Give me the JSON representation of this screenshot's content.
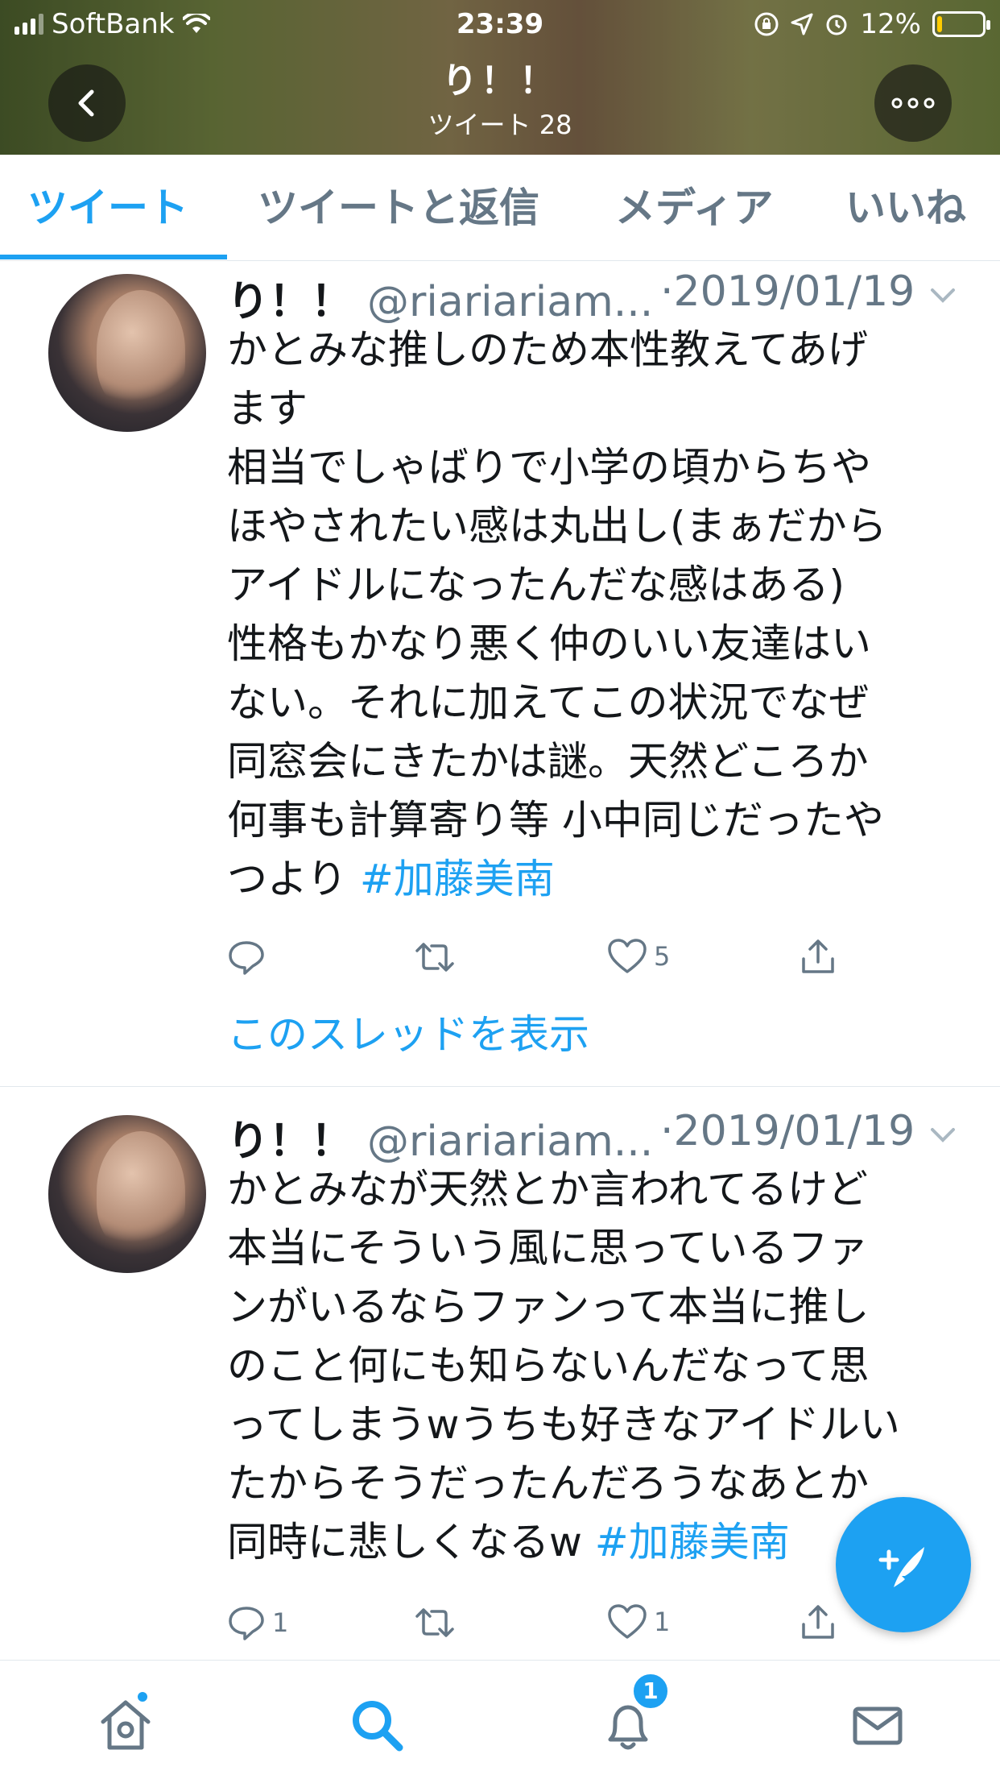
{
  "status_bar": {
    "carrier": "SoftBank",
    "time": "23:39",
    "battery": "12%",
    "battery_level": 0.12
  },
  "header": {
    "title": "り！！",
    "subtitle": "ツイート 28"
  },
  "tabs": [
    {
      "label": "ツイート",
      "active": true
    },
    {
      "label": "ツイートと返信",
      "active": false
    },
    {
      "label": "メディア",
      "active": false
    },
    {
      "label": "いいね",
      "active": false
    }
  ],
  "tweets": [
    {
      "name": "り！！",
      "handle": "@riariariam...",
      "date": "·2019/01/19",
      "text": "かとみな推しのため本性教えてあげ\nます\n相当でしゃばりで小学の頃からちや\nほやされたい感は丸出し(まぁだから\nアイドルになったんだな感はある)\n性格もかなり悪く仲のいい友達はい\nない。それに加えてこの状況でなぜ\n同窓会にきたかは謎。天然どころか\n何事も計算寄り等 小中同じだったや\nつより ",
      "hashtag": "#加藤美南",
      "replies": "",
      "retweets": "",
      "likes": "5",
      "thread_link": "このスレッドを表示"
    },
    {
      "name": "り！！",
      "handle": "@riariariam...",
      "date": "·2019/01/19",
      "text": "かとみなが天然とか言われてるけど\n本当にそういう風に思っているファ\nンがいるならファンって本当に推し\nのこと何にも知らないんだなって思\nってしまうwうちも好きなアイドルい\nたからそうだったんだろうなあとか\n同時に悲しくなるw ",
      "hashtag": "#加藤美南",
      "replies": "1",
      "retweets": "",
      "likes": "1"
    }
  ],
  "bottom_nav": {
    "notifications_badge": "1"
  },
  "colors": {
    "accent": "#1da1f2",
    "muted": "#657786",
    "text": "#14171a"
  }
}
